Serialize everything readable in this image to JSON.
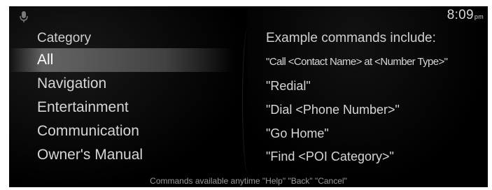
{
  "status_bar": {
    "mic_icon": "microphone-icon",
    "time": "8:09",
    "ampm": "pm"
  },
  "category": {
    "header": "Category",
    "items": [
      {
        "label": "All",
        "selected": true
      },
      {
        "label": "Navigation",
        "selected": false
      },
      {
        "label": "Entertainment",
        "selected": false
      },
      {
        "label": "Communication",
        "selected": false
      },
      {
        "label": "Owner's Manual",
        "selected": false
      }
    ]
  },
  "examples": {
    "header": "Example commands include:",
    "items": [
      "\"Call <Contact Name> at <Number Type>\"",
      "\"Redial\"",
      "\"Dial <Phone Number>\"",
      "\"Go Home\"",
      "\"Find <POI Category>\""
    ]
  },
  "footer": {
    "text": "Commands available anytime \"Help\" \"Back\" \"Cancel\""
  },
  "colors": {
    "background": "#000000",
    "text": "#d6d6d6",
    "selection": "#8c8c8c"
  }
}
